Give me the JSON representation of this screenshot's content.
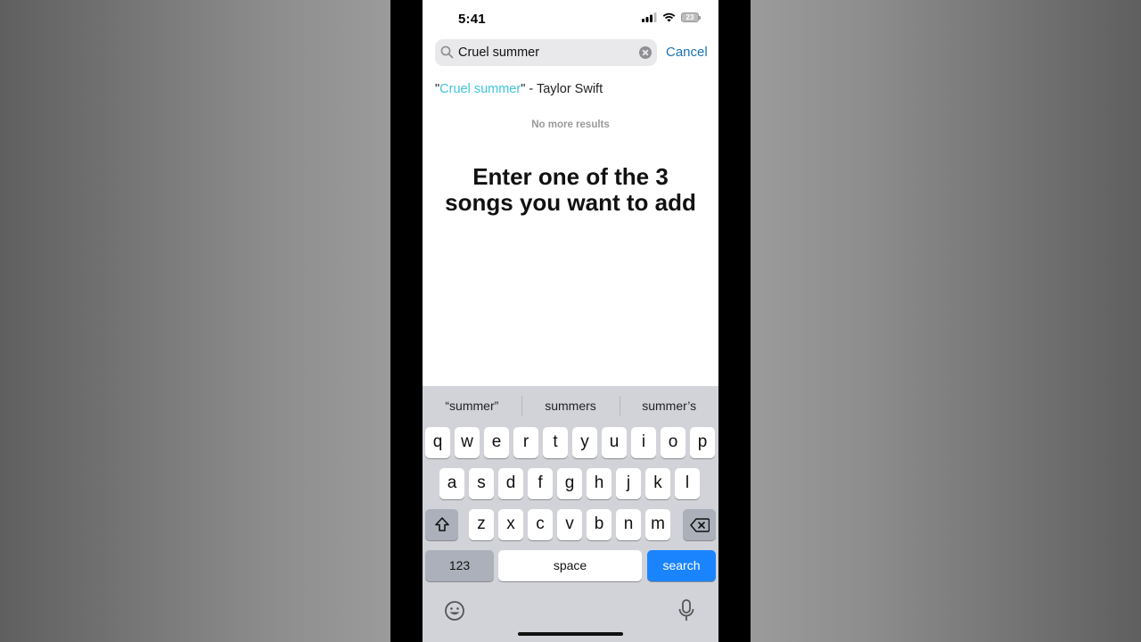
{
  "status": {
    "time": "5:41",
    "battery": "23"
  },
  "search": {
    "value": "Cruel summer",
    "cancel_label": "Cancel"
  },
  "result": {
    "quote_open": "\"",
    "highlight": "Cruel summer",
    "rest": "\" - Taylor Swift"
  },
  "no_more": "No more results",
  "caption": "Enter one of the 3 songs you want to add",
  "suggestions": [
    "“summer”",
    "summers",
    "summer’s"
  ],
  "keys": {
    "row1": [
      "q",
      "w",
      "e",
      "r",
      "t",
      "y",
      "u",
      "i",
      "o",
      "p"
    ],
    "row2": [
      "a",
      "s",
      "d",
      "f",
      "g",
      "h",
      "j",
      "k",
      "l"
    ],
    "row3": [
      "z",
      "x",
      "c",
      "v",
      "b",
      "n",
      "m"
    ],
    "numbers": "123",
    "space": "space",
    "search": "search"
  },
  "colors": {
    "highlight": "#3ec6d9",
    "cancel": "#1a73b8",
    "search_key": "#1a84ff"
  }
}
